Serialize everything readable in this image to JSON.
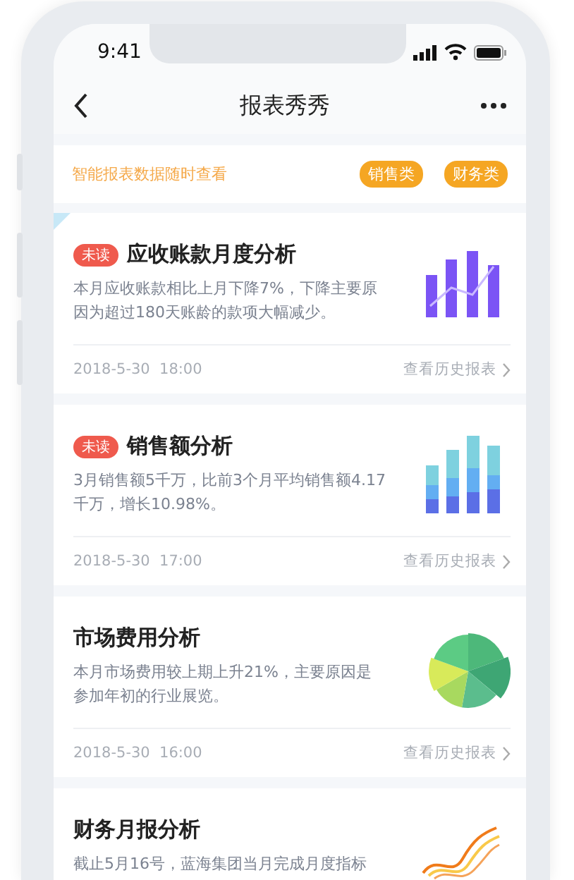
{
  "status_bar": {
    "time": "9:41"
  },
  "nav": {
    "title": "报表秀秀"
  },
  "filter": {
    "text": "智能报表数据随时查看",
    "tags": [
      "销售类",
      "财务类"
    ]
  },
  "cards": [
    {
      "flagged": true,
      "badge": "未读",
      "title": "应收账款月度分析",
      "description": "本月应收账款相比上月下降7%，下降主要原因为超过180天账龄的款项大幅减少。",
      "time": "2018-5-30  18:00",
      "link": "查看历史报表",
      "kind": "bar"
    },
    {
      "flagged": false,
      "badge": "未读",
      "title": "销售额分析",
      "description": "3月销售额5千万，比前3个月平均销售额4.17千万，增长10.98%。",
      "time": "2018-5-30  17:00",
      "link": "查看历史报表",
      "kind": "stacked"
    },
    {
      "flagged": false,
      "title": "市场费用分析",
      "description": "本月市场费用较上期上升21%，主要原因是参加年初的行业展览。",
      "time": "2018-5-30  16:00",
      "link": "查看历史报表",
      "kind": "pie"
    },
    {
      "flagged": false,
      "title": "财务月报分析",
      "description": "截止5月16号，蓝海集团当月完成月度指标",
      "kind": "line"
    }
  ]
}
